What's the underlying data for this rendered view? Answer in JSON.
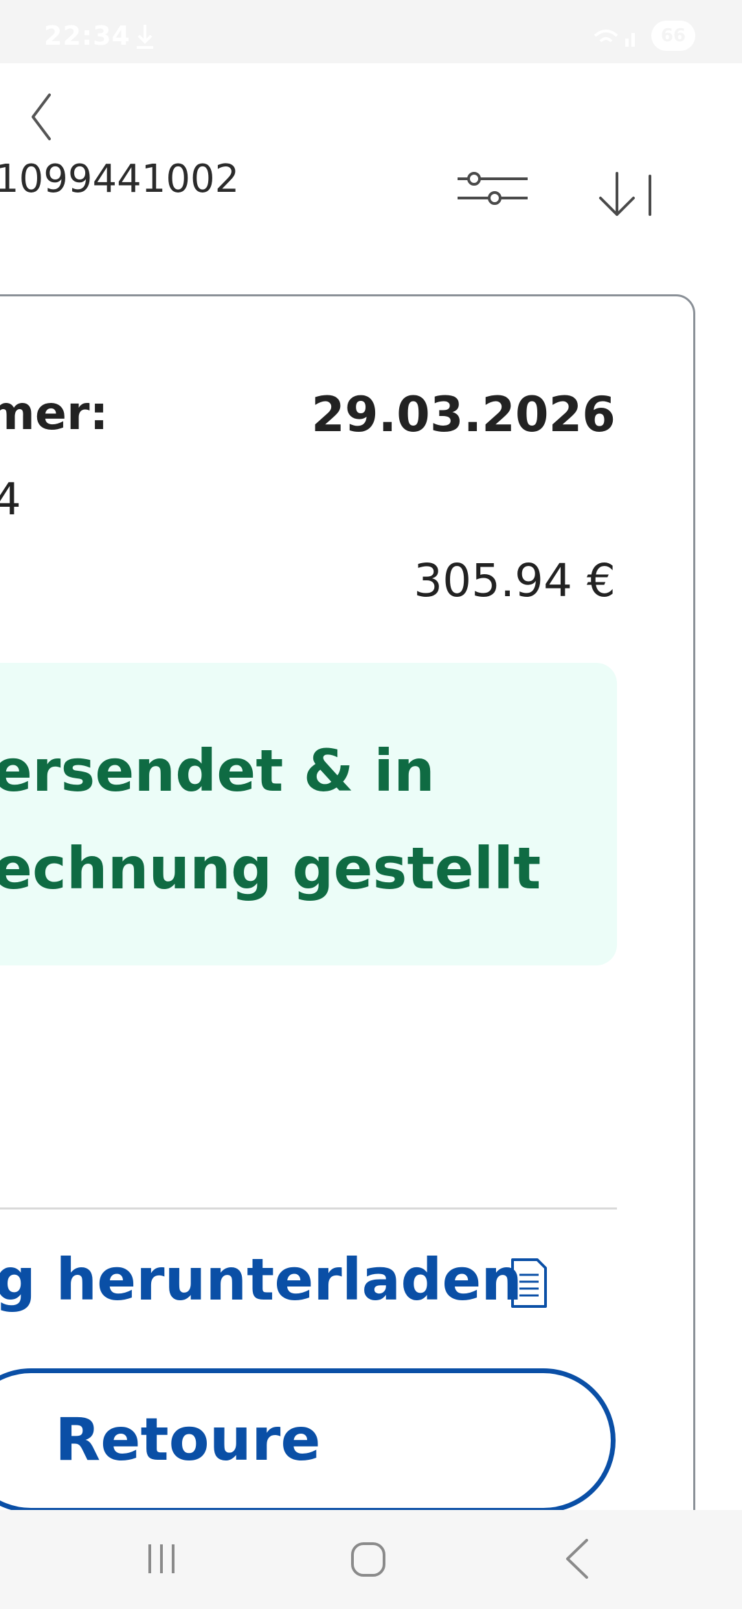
{
  "status_bar": {
    "time": "22:34",
    "battery": "66"
  },
  "header": {
    "order_number": "1099441002"
  },
  "order": {
    "label": "mer:",
    "date": "29.03.2026",
    "code_tail": "4",
    "total": "305.94 €",
    "status": "ersendet & in\nechnung gestellt",
    "invoice_link": "g herunterladen",
    "retoure_label": "Retoure"
  },
  "colors": {
    "brand_blue": "#0a4fa6",
    "status_green": "#0f6b43",
    "status_bg": "#ecfdf8"
  },
  "icons": {
    "back": "chevron-left-icon",
    "filter": "sliders-icon",
    "sort": "sort-down-icon",
    "document": "document-icon"
  }
}
